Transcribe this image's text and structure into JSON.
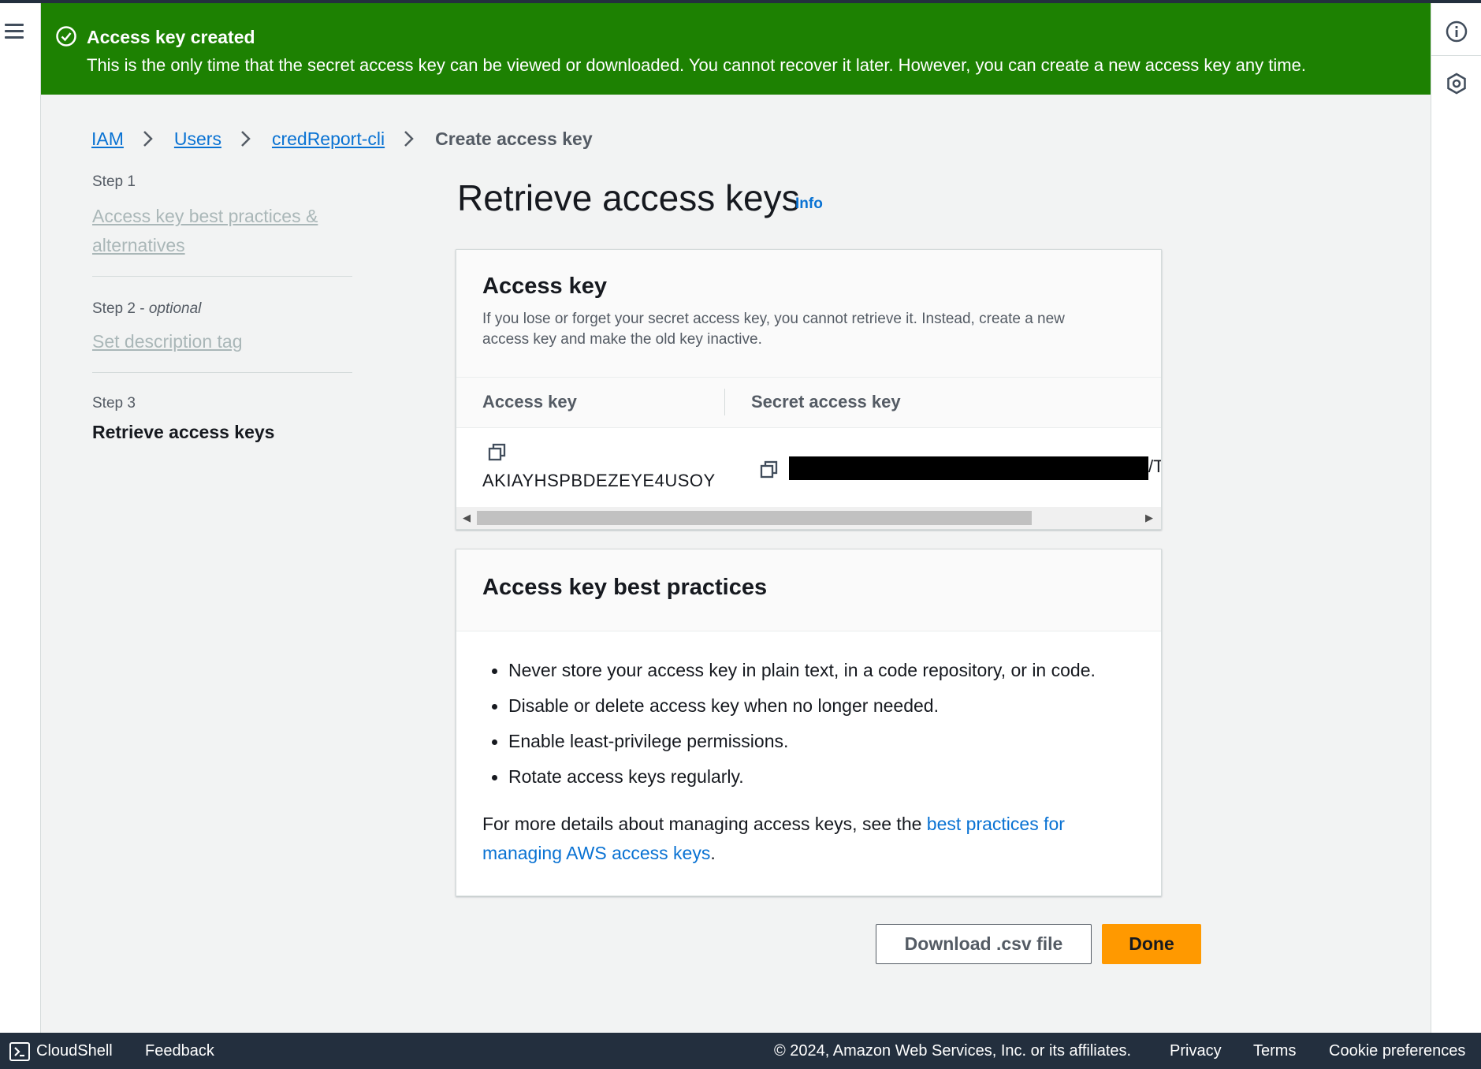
{
  "flash": {
    "title": "Access key created",
    "message": "This is the only time that the secret access key can be viewed or downloaded. You cannot recover it later. However, you can create a new access key any time."
  },
  "breadcrumb": {
    "items": [
      "IAM",
      "Users",
      "credReport-cli"
    ],
    "current": "Create access key"
  },
  "steps": [
    {
      "label": "Step 1",
      "optional": "",
      "title": "Access key best practices & alternatives"
    },
    {
      "label": "Step 2 - ",
      "optional": "optional",
      "title": "Set description tag"
    },
    {
      "label": "Step 3",
      "optional": "",
      "title": "Retrieve access keys"
    }
  ],
  "page": {
    "title": "Retrieve access keys",
    "info": "Info"
  },
  "access_key_card": {
    "title": "Access key",
    "description": "If you lose or forget your secret access key, you cannot retrieve it. Instead, create a new access key and make the old key inactive.",
    "columns": [
      "Access key",
      "Secret access key"
    ],
    "access_key_value": "AKIAYHSPBDEZEYE4USOY",
    "secret_visible_tail": "/T"
  },
  "best_practices_card": {
    "title": "Access key best practices",
    "items": [
      "Never store your access key in plain text, in a code repository, or in code.",
      "Disable or delete access key when no longer needed.",
      "Enable least-privilege permissions.",
      "Rotate access keys regularly."
    ],
    "note_prefix": "For more details about managing access keys, see the ",
    "note_link": "best practices for managing AWS access keys",
    "note_suffix": "."
  },
  "buttons": {
    "download": "Download .csv file",
    "done": "Done"
  },
  "footer": {
    "cloudshell": "CloudShell",
    "feedback": "Feedback",
    "copyright": "© 2024, Amazon Web Services, Inc. or its affiliates.",
    "privacy": "Privacy",
    "terms": "Terms",
    "cookies": "Cookie preferences"
  },
  "colors": {
    "success": "#1d8102",
    "link": "#0972d3",
    "primary_button": "#ff9900",
    "footer_bg": "#232f3e"
  },
  "icons": [
    "menu-icon",
    "check-circle-icon",
    "info-circle-icon",
    "settings-hex-icon",
    "chevron-right-icon",
    "copy-icon",
    "cloudshell-icon"
  ]
}
